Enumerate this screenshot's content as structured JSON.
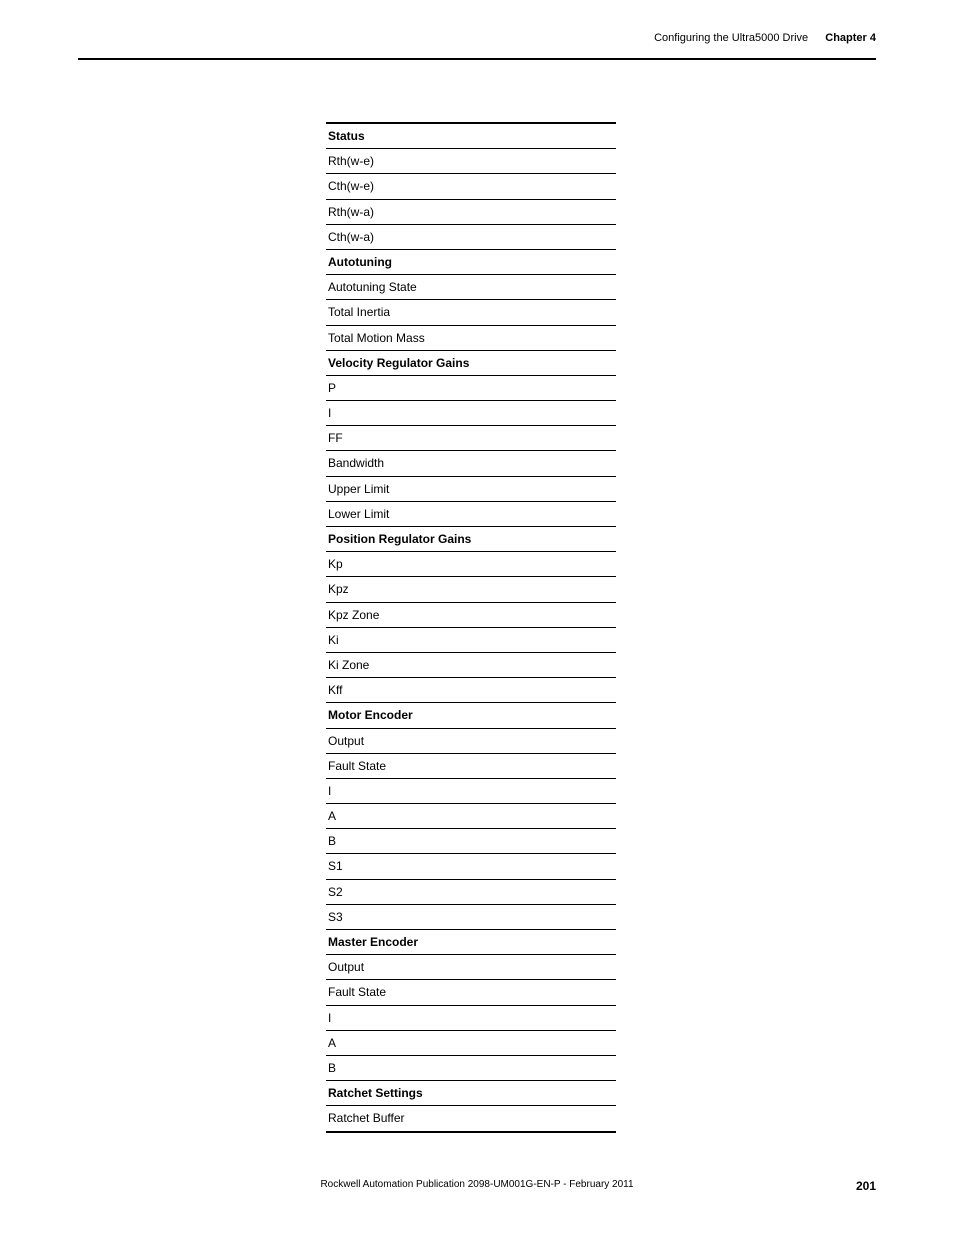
{
  "header": {
    "section": "Configuring the Ultra5000 Drive",
    "chapter": "Chapter 4"
  },
  "table": {
    "rows": [
      {
        "label": "Status",
        "kind": "header"
      },
      {
        "label": "Rth(w-e)",
        "kind": "row"
      },
      {
        "label": "Cth(w-e)",
        "kind": "row"
      },
      {
        "label": "Rth(w-a)",
        "kind": "row"
      },
      {
        "label": "Cth(w-a)",
        "kind": "row"
      },
      {
        "label": "Autotuning",
        "kind": "subheader"
      },
      {
        "label": "Autotuning State",
        "kind": "row"
      },
      {
        "label": "Total Inertia",
        "kind": "row"
      },
      {
        "label": "Total Motion Mass",
        "kind": "row"
      },
      {
        "label": "Velocity Regulator Gains",
        "kind": "subheader"
      },
      {
        "label": "P",
        "kind": "row"
      },
      {
        "label": "I",
        "kind": "row"
      },
      {
        "label": "FF",
        "kind": "row"
      },
      {
        "label": "Bandwidth",
        "kind": "row"
      },
      {
        "label": "Upper Limit",
        "kind": "row"
      },
      {
        "label": "Lower Limit",
        "kind": "row"
      },
      {
        "label": "Position Regulator Gains",
        "kind": "subheader"
      },
      {
        "label": "Kp",
        "kind": "row"
      },
      {
        "label": "Kpz",
        "kind": "row"
      },
      {
        "label": "Kpz Zone",
        "kind": "row"
      },
      {
        "label": "Ki",
        "kind": "row"
      },
      {
        "label": "Ki Zone",
        "kind": "row"
      },
      {
        "label": "Kff",
        "kind": "row"
      },
      {
        "label": "Motor Encoder",
        "kind": "subheader"
      },
      {
        "label": "Output",
        "kind": "row"
      },
      {
        "label": "Fault State",
        "kind": "row"
      },
      {
        "label": "I",
        "kind": "row"
      },
      {
        "label": "A",
        "kind": "row"
      },
      {
        "label": "B",
        "kind": "row"
      },
      {
        "label": "S1",
        "kind": "row"
      },
      {
        "label": "S2",
        "kind": "row"
      },
      {
        "label": "S3",
        "kind": "row"
      },
      {
        "label": "Master Encoder",
        "kind": "subheader"
      },
      {
        "label": "Output",
        "kind": "row"
      },
      {
        "label": "Fault State",
        "kind": "row"
      },
      {
        "label": "I",
        "kind": "row"
      },
      {
        "label": "A",
        "kind": "row"
      },
      {
        "label": "B",
        "kind": "row"
      },
      {
        "label": "Ratchet Settings",
        "kind": "subheader"
      },
      {
        "label": "Ratchet Buffer",
        "kind": "last"
      }
    ]
  },
  "footer": {
    "publication": "Rockwell Automation Publication 2098-UM001G-EN-P  - February 2011",
    "page": "201"
  }
}
